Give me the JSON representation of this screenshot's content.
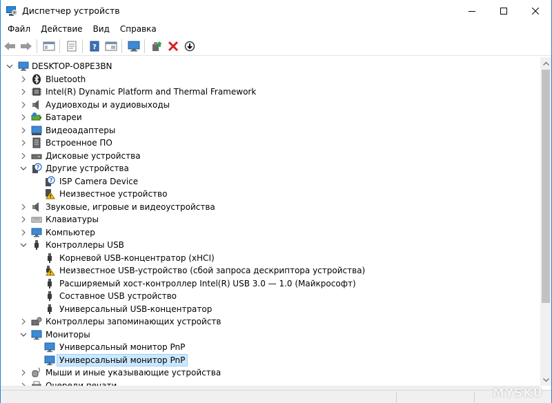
{
  "window": {
    "title": "Диспетчер устройств",
    "accent_color": "#1883d7"
  },
  "menu": [
    "Файл",
    "Действие",
    "Вид",
    "Справка"
  ],
  "toolbar": {
    "buttons": [
      "back-icon",
      "forward-icon",
      "console-tree-icon",
      "properties-icon",
      "help-icon",
      "show-hidden-icon",
      "monitor-scan-icon",
      "update-driver-icon",
      "uninstall-icon",
      "disable-icon"
    ]
  },
  "tree": {
    "root": "DESKTOP-O8PE3BN",
    "items": [
      {
        "label": "Bluetooth",
        "icon": "bluetooth-icon",
        "level": 1,
        "state": "collapsed"
      },
      {
        "label": "Intel(R) Dynamic Platform and Thermal Framework",
        "icon": "chip-icon",
        "level": 1,
        "state": "collapsed"
      },
      {
        "label": "Аудиовходы и аудиовыходы",
        "icon": "speaker-icon",
        "level": 1,
        "state": "collapsed"
      },
      {
        "label": "Батареи",
        "icon": "battery-icon",
        "level": 1,
        "state": "collapsed"
      },
      {
        "label": "Видеоадаптеры",
        "icon": "display-adapter-icon",
        "level": 1,
        "state": "collapsed"
      },
      {
        "label": "Встроенное ПО",
        "icon": "firmware-icon",
        "level": 1,
        "state": "collapsed"
      },
      {
        "label": "Дисковые устройства",
        "icon": "disk-icon",
        "level": 1,
        "state": "collapsed"
      },
      {
        "label": "Другие устройства",
        "icon": "unknown-device-icon",
        "level": 1,
        "state": "expanded"
      },
      {
        "label": "ISP Camera Device",
        "icon": "unknown-device-icon",
        "level": 2,
        "state": "leaf"
      },
      {
        "label": "Неизвестное устройство",
        "icon": "warning-device-icon",
        "level": 2,
        "state": "leaf"
      },
      {
        "label": "Звуковые, игровые и видеоустройства",
        "icon": "speaker-icon",
        "level": 1,
        "state": "collapsed"
      },
      {
        "label": "Клавиатуры",
        "icon": "keyboard-icon",
        "level": 1,
        "state": "collapsed"
      },
      {
        "label": "Компьютер",
        "icon": "computer-icon",
        "level": 1,
        "state": "collapsed"
      },
      {
        "label": "Контроллеры USB",
        "icon": "usb-icon",
        "level": 1,
        "state": "expanded"
      },
      {
        "label": "Корневой USB-концентратор (xHCI)",
        "icon": "usb-icon",
        "level": 2,
        "state": "leaf"
      },
      {
        "label": "Неизвестное USB-устройство (сбой запроса дескриптора устройства)",
        "icon": "usb-warning-icon",
        "level": 2,
        "state": "leaf"
      },
      {
        "label": "Расширяемый хост-контроллер Intel(R) USB 3.0 — 1.0 (Майкрософт)",
        "icon": "usb-icon",
        "level": 2,
        "state": "leaf"
      },
      {
        "label": "Составное USB устройство",
        "icon": "usb-icon",
        "level": 2,
        "state": "leaf"
      },
      {
        "label": "Универсальный USB-концентратор",
        "icon": "usb-icon",
        "level": 2,
        "state": "leaf"
      },
      {
        "label": "Контроллеры запоминающих устройств",
        "icon": "storage-controller-icon",
        "level": 1,
        "state": "collapsed"
      },
      {
        "label": "Мониторы",
        "icon": "monitor-icon",
        "level": 1,
        "state": "expanded"
      },
      {
        "label": "Универсальный монитор PnP",
        "icon": "monitor-icon",
        "level": 2,
        "state": "leaf"
      },
      {
        "label": "Универсальный монитор PnP",
        "icon": "monitor-icon",
        "level": 2,
        "state": "leaf",
        "selected": true
      },
      {
        "label": "Мыши и иные указывающие устройства",
        "icon": "mouse-icon",
        "level": 1,
        "state": "collapsed"
      },
      {
        "label": "Очереди печати",
        "icon": "printer-icon",
        "level": 1,
        "state": "collapsed"
      }
    ]
  },
  "watermark": "MYSKU"
}
